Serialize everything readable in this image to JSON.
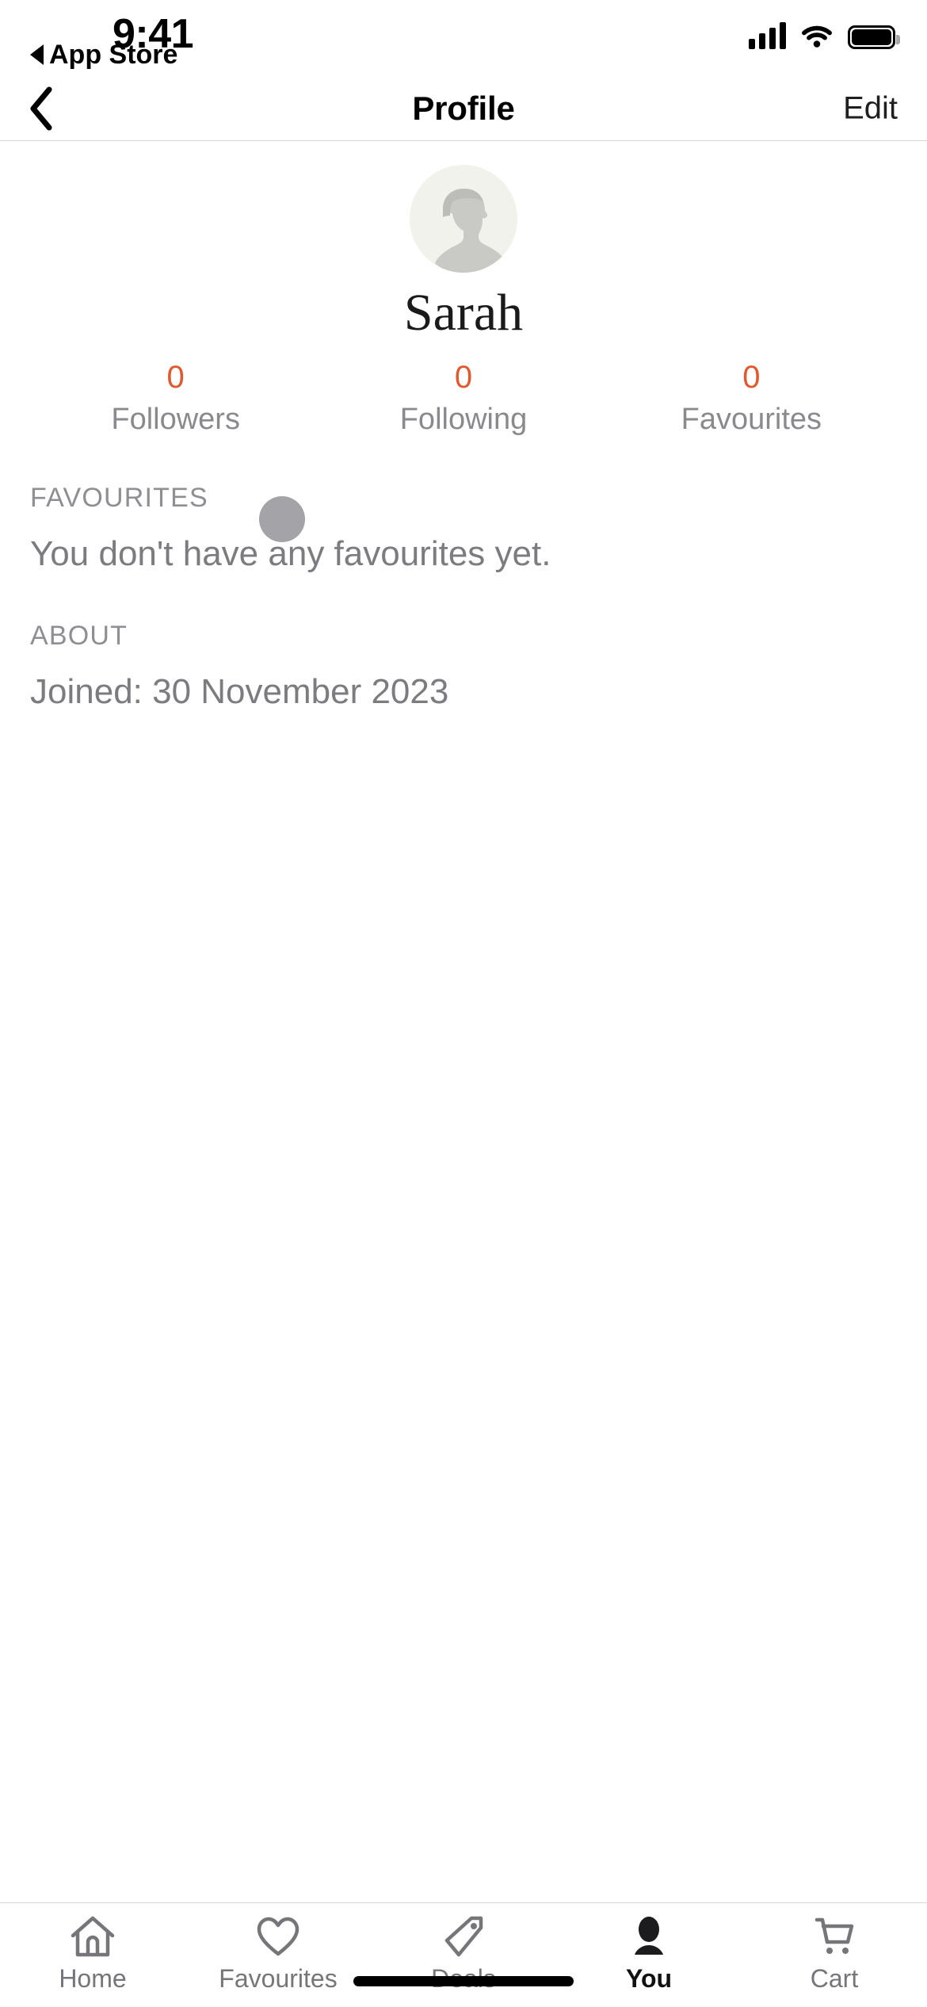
{
  "status_bar": {
    "time": "9:41",
    "back_app_label": "App Store",
    "back_app_icon": "triangle-left-icon",
    "signal_icon": "cellular-signal-icon",
    "wifi_icon": "wifi-icon",
    "battery_icon": "battery-full-icon"
  },
  "nav": {
    "back_icon": "chevron-left-icon",
    "title": "Profile",
    "edit_label": "Edit"
  },
  "profile": {
    "avatar_icon": "person-placeholder-avatar",
    "status_dot_icon": "status-dot",
    "name": "Sarah",
    "stats": [
      {
        "value": "0",
        "label": "Followers"
      },
      {
        "value": "0",
        "label": "Following"
      },
      {
        "value": "0",
        "label": "Favourites"
      }
    ]
  },
  "sections": [
    {
      "header": "FAVOURITES",
      "body": "You don't have any favourites yet."
    },
    {
      "header": "ABOUT",
      "body": "Joined: 30 November 2023"
    }
  ],
  "tabbar": {
    "items": [
      {
        "label": "Home",
        "icon": "home-icon",
        "active": false
      },
      {
        "label": "Favourites",
        "icon": "heart-icon",
        "active": false
      },
      {
        "label": "Deals",
        "icon": "tag-icon",
        "active": false
      },
      {
        "label": "You",
        "icon": "person-icon",
        "active": true
      },
      {
        "label": "Cart",
        "icon": "cart-icon",
        "active": false
      }
    ]
  },
  "colors": {
    "accent_orange": "#e1592c",
    "muted_gray": "#8a8a8e",
    "body_gray": "#7c7c80",
    "divider": "#d6d6d8",
    "avatar_bg": "#f2f2ec",
    "avatar_fig": "#c9c9c5"
  },
  "home_indicator": "home-indicator"
}
